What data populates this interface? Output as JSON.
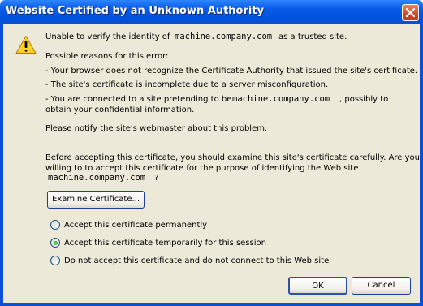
{
  "window": {
    "title": "Website Certified by an Unknown Authority"
  },
  "site": "machine.company.com",
  "message": {
    "line1_prefix": "Unable to verify the identity of",
    "line1_suffix": "as a trusted site.",
    "reasons_heading": "Possible reasons for this error:",
    "reason1": "- Your browser does not recognize the Certificate Authority that issued the site's certificate.",
    "reason2": "- The site's certificate is incomplete due to a server misconfiguration.",
    "reason3_prefix": "- You are connected to a site pretending to be",
    "reason3_suffix": ", possibly to",
    "reason3_line2": "obtain your confidential information.",
    "notify": "Please notify the site's webmaster about this problem.",
    "before_line1": "Before accepting this certificate, you should examine this site's certificate carefully. Are you",
    "before_line2": "willing to to accept this certificate for the purpose of identifying the Web site",
    "before_q": "?"
  },
  "buttons": {
    "examine": "Examine Certificate...",
    "ok": "OK",
    "cancel": "Cancel"
  },
  "options": [
    {
      "label": "Accept this certificate permanently",
      "selected": false
    },
    {
      "label": "Accept this certificate temporarily for this session",
      "selected": true
    },
    {
      "label": "Do not accept this certificate and do not connect to this Web site",
      "selected": false
    }
  ],
  "icons": {
    "warning": "warning-triangle-icon",
    "close": "close-icon"
  }
}
